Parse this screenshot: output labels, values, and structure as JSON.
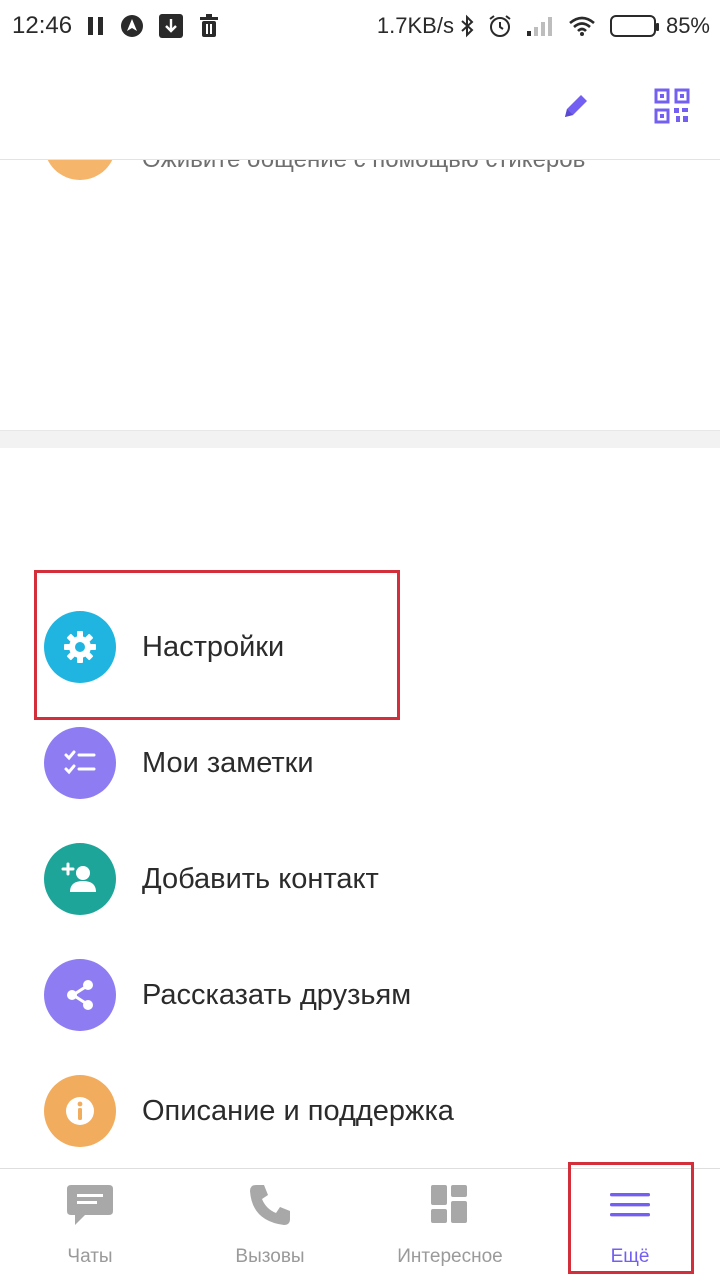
{
  "status_bar": {
    "time": "12:46",
    "net_speed": "1.7KB/s",
    "battery_percent": "85%",
    "battery_level": 0.85,
    "icons": [
      "pause-icon",
      "navigation-icon",
      "download-icon",
      "trash-icon",
      "bluetooth-icon",
      "alarm-icon",
      "signal-icon",
      "wifi-icon",
      "battery-icon"
    ]
  },
  "app_bar": {
    "actions": [
      "edit-icon",
      "qr-code-icon"
    ],
    "accent": "#7360f2"
  },
  "scrolled_content": {
    "partial_text": "Оживите общение с помощью стикеров"
  },
  "menu": {
    "items": [
      {
        "label": "Настройки",
        "icon": "gear-icon",
        "color": "#1fb5e0"
      },
      {
        "label": "Мои заметки",
        "icon": "checklist-icon",
        "color": "#8e7cf3"
      },
      {
        "label": "Добавить контакт",
        "icon": "add-person-icon",
        "color": "#1da59a"
      },
      {
        "label": "Рассказать друзьям",
        "icon": "share-icon",
        "color": "#8e7cf3"
      },
      {
        "label": "Описание и поддержка",
        "icon": "info-icon",
        "color": "#f2ac5e"
      }
    ]
  },
  "bottom_nav": {
    "tabs": [
      {
        "label": "Чаты",
        "icon": "chat-icon",
        "active": false
      },
      {
        "label": "Вызовы",
        "icon": "phone-icon",
        "active": false
      },
      {
        "label": "Интересное",
        "icon": "explore-grid-icon",
        "active": false
      },
      {
        "label": "Ещё",
        "icon": "menu-icon",
        "active": true
      }
    ]
  },
  "annotations": {
    "highlight_color": "#d32f3a"
  }
}
